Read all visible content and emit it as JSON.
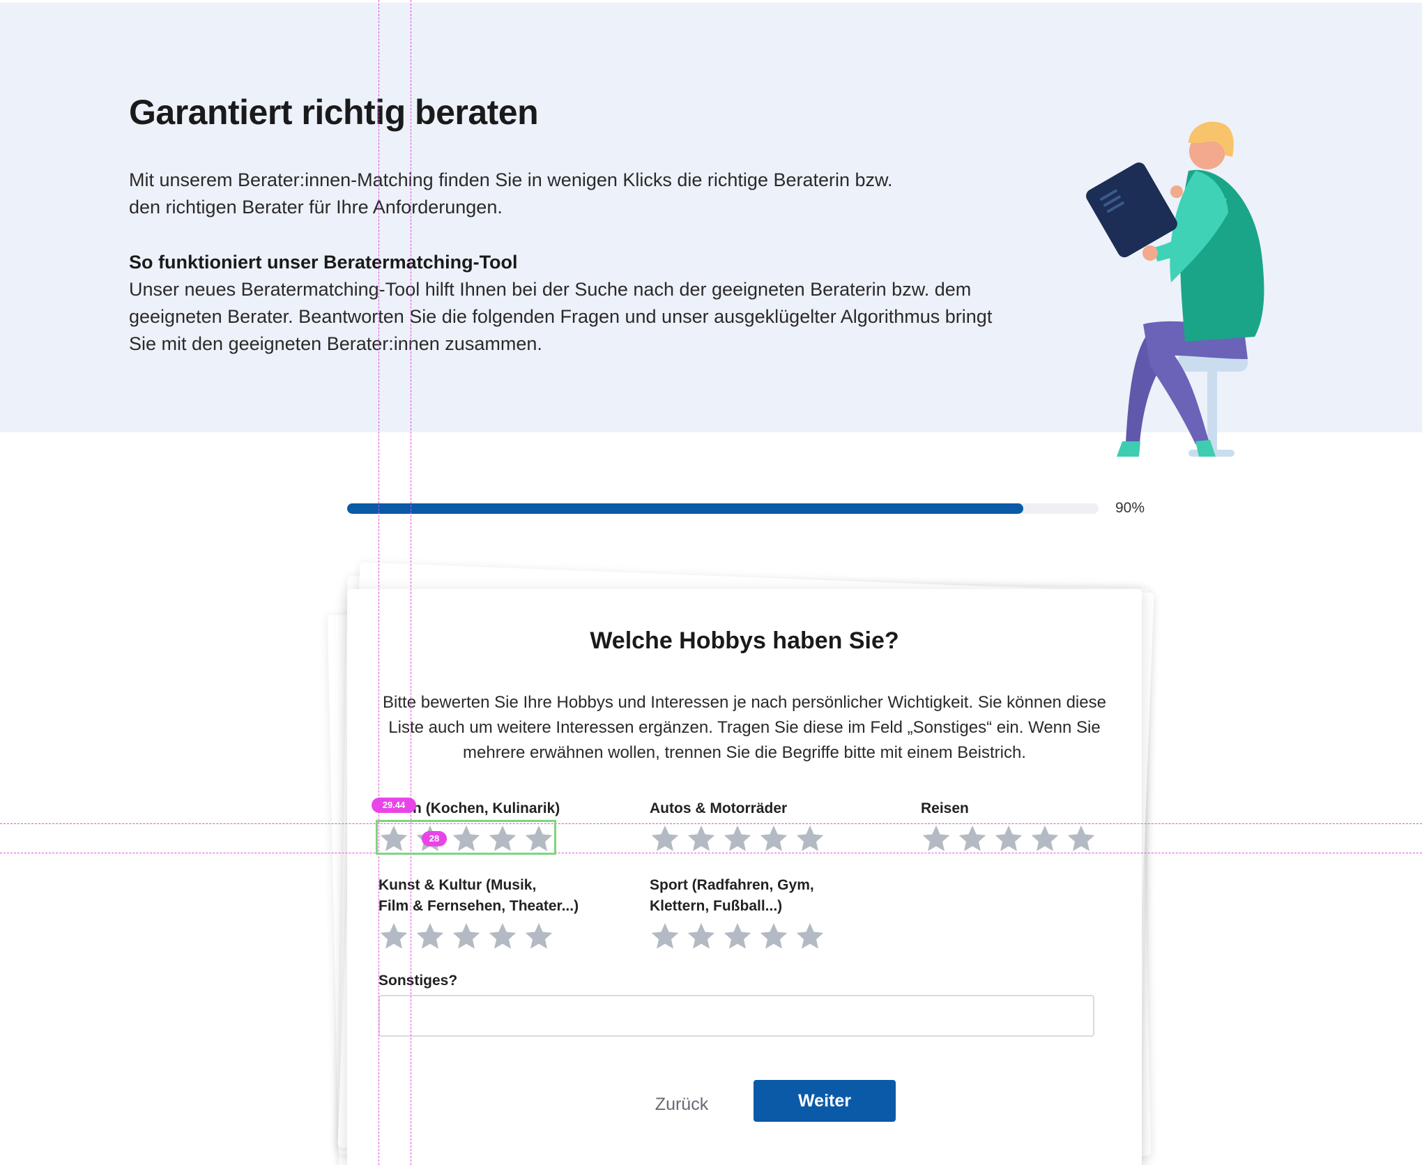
{
  "hero": {
    "title": "Garantiert richtig beraten",
    "intro": "Mit unserem Berater:innen-Matching finden Sie in wenigen Klicks die richtige Beraterin bzw. den richtigen Berater für Ihre Anforderungen.",
    "subheading": "So funktioniert unser Beratermatching-Tool",
    "body": "Unser neues Beratermatching-Tool hilft Ihnen bei der Suche nach der geeigneten Beraterin bzw. dem geeigneten Berater. Beantworten Sie die folgenden Fragen und unser ausgeklügelter Algorithmus bringt Sie mit den geeigneten Berater:innen zusammen."
  },
  "progress": {
    "percent": 90,
    "label": "90%"
  },
  "question": {
    "title": "Welche Hobbys haben Sie?",
    "description": "Bitte bewerten Sie Ihre Hobbys und Interessen je nach persönlicher Wichtigkeit. Sie können diese Liste auch um weitere Interessen ergänzen. Tragen Sie diese im Feld „Sonstiges“ ein. Wenn Sie mehrere erwähnen wollen, trennen Sie die Begriffe bitte mit einem Beistrich.",
    "ratings": [
      {
        "label": "Essen (Kochen, Kulinarik)",
        "stars": 5,
        "value": 0
      },
      {
        "label": "Autos & Motorräder",
        "stars": 5,
        "value": 0
      },
      {
        "label": "Reisen",
        "stars": 5,
        "value": 0
      },
      {
        "label": "Kunst & Kultur (Musik,\nFilm & Fernsehen, Theater...)",
        "stars": 5,
        "value": 0
      },
      {
        "label": "Sport (Radfahren, Gym,\nKlettern, Fußball...)",
        "stars": 5,
        "value": 0
      }
    ],
    "other": {
      "label": "Sonstiges?",
      "value": "",
      "placeholder": ""
    }
  },
  "buttons": {
    "back": "Zurück",
    "next": "Weiter"
  },
  "overlay": {
    "width_badge": "29.44",
    "gap_badge": "28"
  },
  "colors": {
    "primary": "#0a5aa8",
    "hero_bg": "#edf1f9",
    "star": "#b4bac3",
    "guide": "#e04ee0"
  }
}
